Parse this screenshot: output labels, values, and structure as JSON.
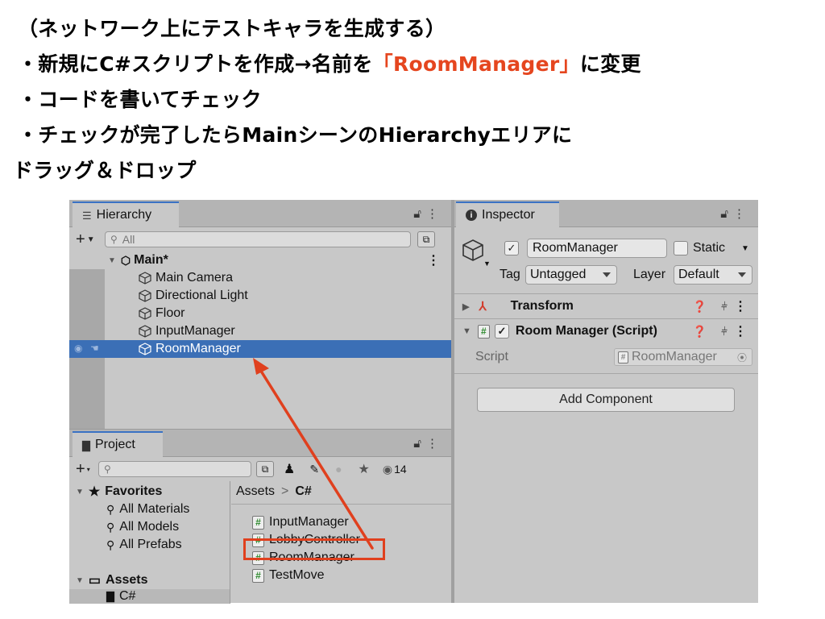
{
  "notes": {
    "line1": "（ネットワーク上にテストキャラを生成する）",
    "line2_pre": "・新規にC#スクリプトを作成→名前を",
    "line2_accent": "「RoomManager」",
    "line2_post": "に変更",
    "line3": "・コードを書いてチェック",
    "line4": "・チェックが完了したらMainシーンのHierarchyエリアに",
    "line5": "ドラッグ＆ドロップ"
  },
  "colors": {
    "accent": "#e5461f",
    "selection": "#3b6fb6",
    "tab_highlight": "#3a72c4"
  },
  "hierarchy": {
    "tab_label": "Hierarchy",
    "search_placeholder": "All",
    "scene": "Main*",
    "items": [
      "Main Camera",
      "Directional Light",
      "Floor",
      "InputManager",
      "RoomManager"
    ],
    "selected": "RoomManager"
  },
  "project": {
    "tab_label": "Project",
    "badge_count": "14",
    "favorites_label": "Favorites",
    "favorites": [
      "All Materials",
      "All Models",
      "All Prefabs"
    ],
    "assets_label": "Assets",
    "csharp_folder": "C#",
    "breadcrumb_root": "Assets",
    "breadcrumb_sep": ">",
    "breadcrumb_current": "C#",
    "files": [
      "InputManager",
      "LobbyController",
      "RoomManager",
      "TestMove"
    ],
    "highlighted_file": "RoomManager"
  },
  "inspector": {
    "tab_label": "Inspector",
    "object_name": "RoomManager",
    "static_label": "Static",
    "tag_label": "Tag",
    "tag_value": "Untagged",
    "layer_label": "Layer",
    "layer_value": "Default",
    "transform_label": "Transform",
    "script_component_label": "Room Manager (Script)",
    "script_field_label": "Script",
    "script_field_value": "RoomManager",
    "add_component_label": "Add Component"
  }
}
